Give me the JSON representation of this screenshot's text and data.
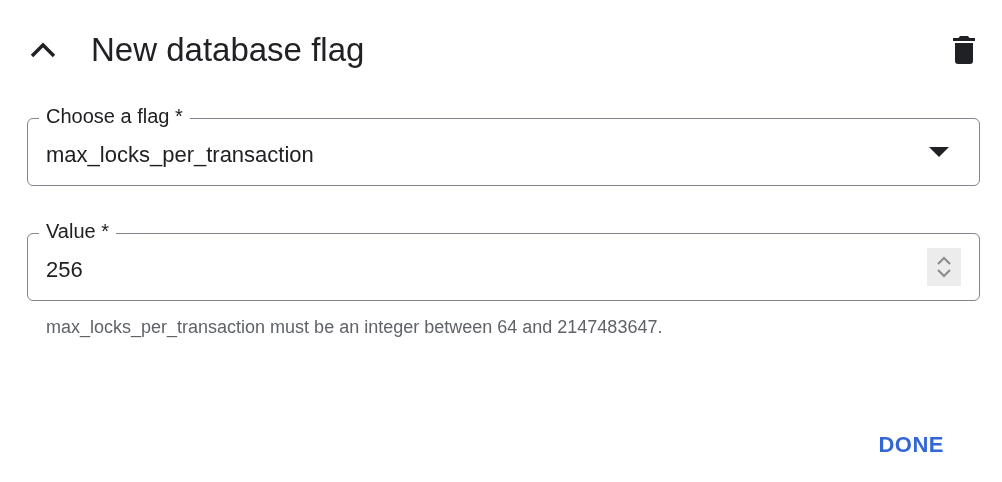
{
  "header": {
    "title": "New database flag",
    "expanded": true
  },
  "flag_field": {
    "label": "Choose a flag *",
    "value": "max_locks_per_transaction"
  },
  "value_field": {
    "label": "Value *",
    "value": "256",
    "hint": "max_locks_per_transaction must be an integer between 64 and 2147483647."
  },
  "buttons": [
    {
      "label": "DONE"
    }
  ]
}
